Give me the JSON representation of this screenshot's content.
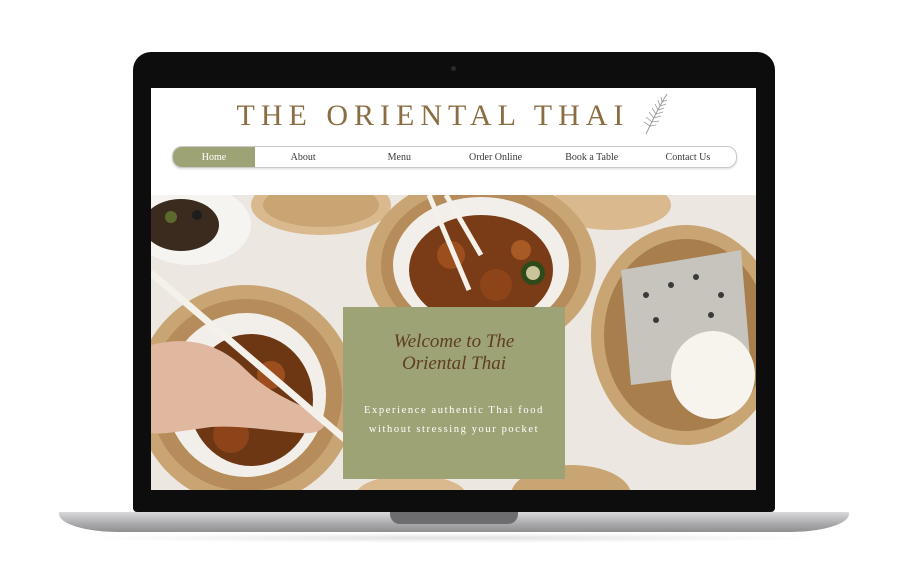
{
  "brand": {
    "title": "THE ORIENTAL THAI"
  },
  "nav": {
    "items": [
      "Home",
      "About",
      "Menu",
      "Order Online",
      "Book a Table",
      "Contact Us"
    ],
    "active": "Home"
  },
  "hero": {
    "title": "Welcome to The Oriental Thai",
    "subtitle": "Experience authentic Thai food without stressing your pocket"
  },
  "colors": {
    "accent": "#9ea375",
    "brand_text": "#8a6d42",
    "title_text": "#5e3d22"
  },
  "icons": {
    "leaf": "leaf-icon"
  }
}
